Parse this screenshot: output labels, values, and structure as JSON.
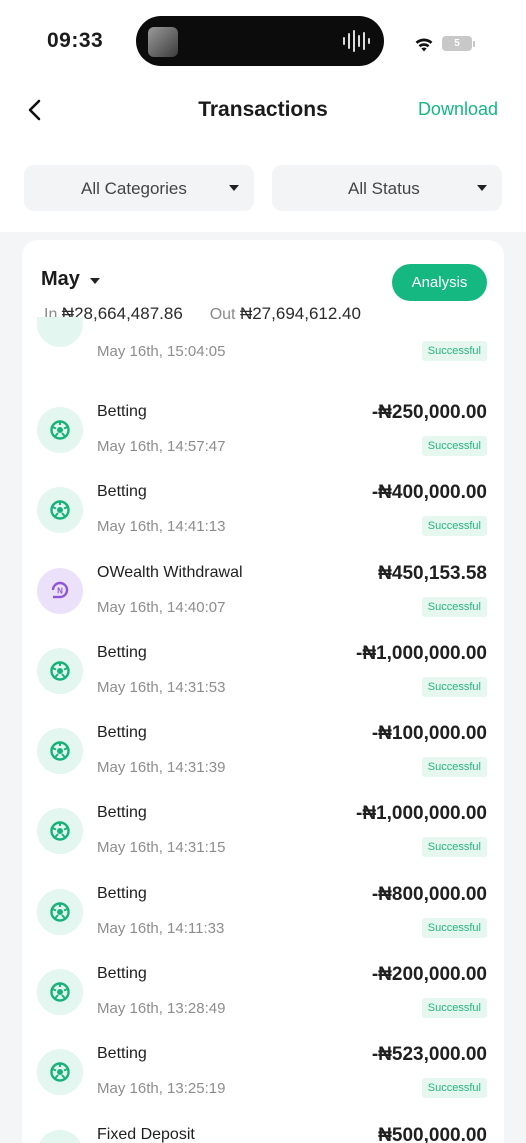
{
  "status_bar": {
    "time": "09:33",
    "battery": "5"
  },
  "header": {
    "title": "Transactions",
    "download_label": "Download"
  },
  "filters": {
    "category": "All Categories",
    "status": "All Status"
  },
  "summary": {
    "month": "May",
    "analysis_label": "Analysis",
    "in_label": "In",
    "in_amount": "₦28,664,487.86",
    "out_label": "Out",
    "out_amount": "₦27,694,612.40"
  },
  "partial_item": {
    "date": "May 16th, 15:04:05",
    "status": "Successful"
  },
  "transactions": [
    {
      "name": "Betting",
      "amount": "-₦250,000.00",
      "date": "May 16th, 14:57:47",
      "status": "Successful",
      "icon": "betting-icon"
    },
    {
      "name": "Betting",
      "amount": "-₦400,000.00",
      "date": "May 16th, 14:41:13",
      "status": "Successful",
      "icon": "betting-icon"
    },
    {
      "name": "OWealth Withdrawal",
      "amount": "₦450,153.58",
      "date": "May 16th, 14:40:07",
      "status": "Successful",
      "icon": "owealth-icon"
    },
    {
      "name": "Betting",
      "amount": "-₦1,000,000.00",
      "date": "May 16th, 14:31:53",
      "status": "Successful",
      "icon": "betting-icon"
    },
    {
      "name": "Betting",
      "amount": "-₦100,000.00",
      "date": "May 16th, 14:31:39",
      "status": "Successful",
      "icon": "betting-icon"
    },
    {
      "name": "Betting",
      "amount": "-₦1,000,000.00",
      "date": "May 16th, 14:31:15",
      "status": "Successful",
      "icon": "betting-icon"
    },
    {
      "name": "Betting",
      "amount": "-₦800,000.00",
      "date": "May 16th, 14:11:33",
      "status": "Successful",
      "icon": "betting-icon"
    },
    {
      "name": "Betting",
      "amount": "-₦200,000.00",
      "date": "May 16th, 13:28:49",
      "status": "Successful",
      "icon": "betting-icon"
    },
    {
      "name": "Betting",
      "amount": "-₦523,000.00",
      "date": "May 16th, 13:25:19",
      "status": "Successful",
      "icon": "betting-icon"
    },
    {
      "name": "Fixed Deposit",
      "amount": "₦500,000.00",
      "date": "",
      "status": "",
      "icon": "fixed-deposit-icon"
    }
  ],
  "colors": {
    "accent": "#14b880",
    "status_text": "#27b57f",
    "status_bg": "#e6f7f0",
    "owealth": "#8e55d8"
  }
}
